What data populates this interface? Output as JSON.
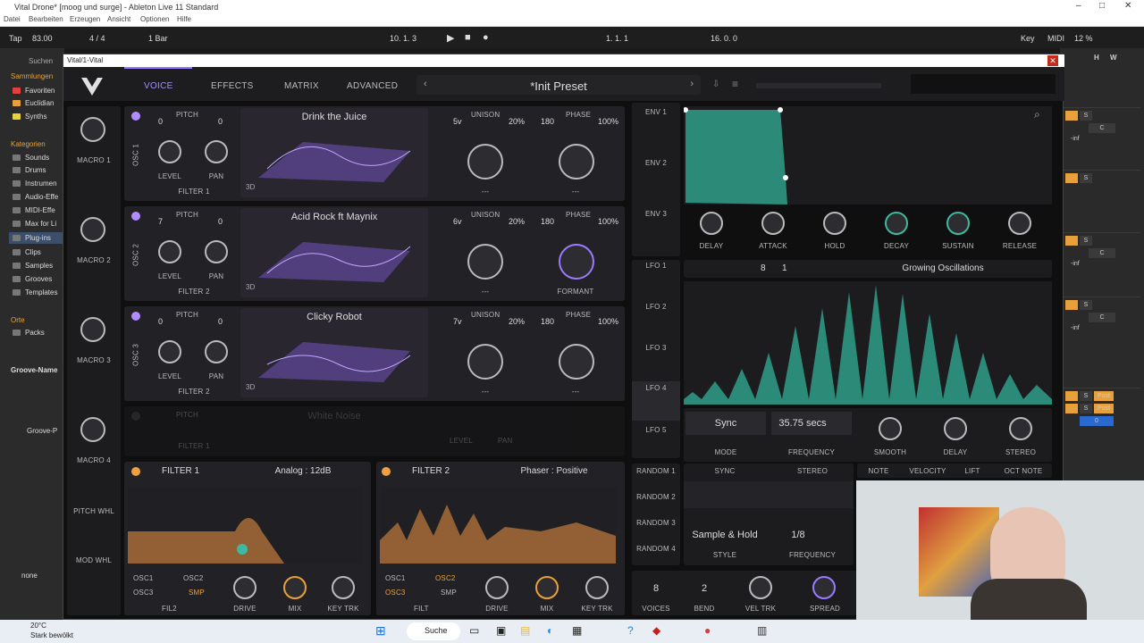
{
  "window_title": "Vital Drone* [moog und surge] - Ableton Live 11 Standard",
  "menu": [
    "Datei",
    "Bearbeiten",
    "Erzeugen",
    "Ansicht",
    "Optionen",
    "Hilfe"
  ],
  "transport": {
    "tap": "Tap",
    "bpm": "83.00",
    "sig": "4 / 4",
    "quant": "1 Bar",
    "pos1": "10. 1. 3",
    "pos2": "1. 1. 1",
    "pos3": "16. 0. 0",
    "key": "Key",
    "midi": "MIDI",
    "zoom": "12 %"
  },
  "browser": {
    "search": "Suchen",
    "collections_header": "Sammlungen",
    "collections": [
      "Favoriten",
      "Euclidian",
      "Synths"
    ],
    "categories_header": "Kategorien",
    "categories": [
      "Sounds",
      "Drums",
      "Instrumen",
      "Audio-Effe",
      "MIDI-Effe",
      "Max for Li",
      "Plug-ins",
      "Clips",
      "Samples",
      "Grooves",
      "Templates"
    ],
    "places_header": "Orte",
    "places": [
      "Packs"
    ],
    "groove_name": "Groove-Name",
    "groove_pool": "Groove-P",
    "none": "none"
  },
  "vital": {
    "title": "Vital/1-Vital",
    "tabs": [
      "VOICE",
      "EFFECTS",
      "MATRIX",
      "ADVANCED"
    ],
    "preset": "*Init Preset",
    "macros": [
      "MACRO 1",
      "MACRO 2",
      "MACRO 3",
      "MACRO 4"
    ],
    "pitch_whl": "PITCH WHL",
    "mod_whl": "MOD WHL",
    "oscs": [
      {
        "label": "OSC 1",
        "pitch_l": "0",
        "pitch_r": "0",
        "pitch": "PITCH",
        "level": "LEVEL",
        "pan": "PAN",
        "filter": "FILTER 1",
        "wave": "Drink the Juice",
        "dim": "3D",
        "unison_v": "5v",
        "unison": "UNISON",
        "unison_pct": "20%",
        "phase_deg": "180",
        "phase": "PHASE",
        "phase_pct": "100%",
        "dash1": "---",
        "dash2": "---"
      },
      {
        "label": "OSC 2",
        "pitch_l": "7",
        "pitch_r": "0",
        "pitch": "PITCH",
        "level": "LEVEL",
        "pan": "PAN",
        "filter": "FILTER 2",
        "wave": "Acid Rock ft Maynix",
        "dim": "3D",
        "unison_v": "6v",
        "unison": "UNISON",
        "unison_pct": "20%",
        "phase_deg": "180",
        "phase": "PHASE",
        "phase_pct": "100%",
        "dash1": "---",
        "dash2": "FORMANT"
      },
      {
        "label": "OSC 3",
        "pitch_l": "0",
        "pitch_r": "0",
        "pitch": "PITCH",
        "level": "LEVEL",
        "pan": "PAN",
        "filter": "FILTER 2",
        "wave": "Clicky Robot",
        "dim": "3D",
        "unison_v": "7v",
        "unison": "UNISON",
        "unison_pct": "20%",
        "phase_deg": "180",
        "phase": "PHASE",
        "phase_pct": "100%",
        "dash1": "---",
        "dash2": "---"
      }
    ],
    "sampler": {
      "wave": "White Noise",
      "pitch": "PITCH",
      "level": "LEVEL",
      "pan": "PAN",
      "filter": "FILTER 1"
    },
    "filters": [
      {
        "label": "FILTER 1",
        "type": "Analog : 12dB",
        "drive": "DRIVE",
        "mix": "MIX",
        "keytrk": "KEY TRK",
        "routes": [
          "OSC1",
          "OSC2",
          "OSC3",
          "SMP"
        ],
        "fil": "FIL2"
      },
      {
        "label": "FILTER 2",
        "type": "Phaser : Positive",
        "drive": "DRIVE",
        "mix": "MIX",
        "keytrk": "KEY TRK",
        "routes": [
          "OSC1",
          "OSC2",
          "OSC3",
          "SMP"
        ],
        "fil": "FILT"
      }
    ],
    "envs": [
      "ENV 1",
      "ENV 2",
      "ENV 3"
    ],
    "env_knobs": [
      "DELAY",
      "ATTACK",
      "HOLD",
      "DECAY",
      "SUSTAIN",
      "RELEASE"
    ],
    "lfos": [
      "LFO 1",
      "LFO 2",
      "LFO 3",
      "LFO 4",
      "LFO 5"
    ],
    "lfo": {
      "grid": "8",
      "grid2": "1",
      "name": "Growing Oscillations",
      "mode_val": "Sync",
      "mode": "MODE",
      "freq_val": "35.75 secs",
      "freq": "FREQUENCY",
      "smooth": "SMOOTH",
      "delay": "DELAY",
      "stereo": "STEREO"
    },
    "randoms": [
      "RANDOM 1",
      "RANDOM 2",
      "RANDOM 3",
      "RANDOM 4"
    ],
    "random": {
      "sync": "SYNC",
      "stereo": "STEREO",
      "style_val": "Sample & Hold",
      "style": "STYLE",
      "freq_val": "1/8",
      "freq": "FREQUENCY"
    },
    "keys": [
      "NOTE",
      "VELOCITY",
      "LIFT",
      "OCT NOTE"
    ],
    "voice": {
      "voices_val": "8",
      "voices": "VOICES",
      "bend_val": "2",
      "bend": "BEND",
      "veltrk": "VEL TRK",
      "spread": "SPREAD"
    }
  },
  "mixer": {
    "s": "S",
    "c": "C",
    "inf": "-inf",
    "post": "Post",
    "zero": "0"
  },
  "taskbar": {
    "temp": "20°C",
    "weather": "Stark bewölkt",
    "search": "Suche"
  },
  "colors": {
    "accent": "#9a7bff",
    "teal": "#3fb8a0",
    "orange": "#e8a13a"
  }
}
